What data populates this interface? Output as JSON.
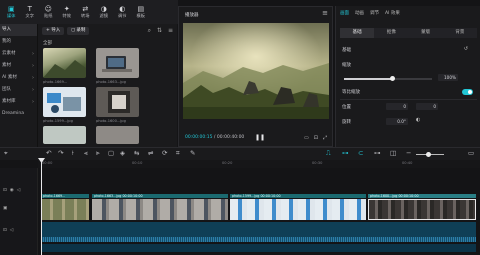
{
  "toolbar": {
    "items": [
      {
        "label": "媒体",
        "icon": "media-icon"
      },
      {
        "label": "文字",
        "icon": "text-icon"
      },
      {
        "label": "贴纸",
        "icon": "sticker-icon"
      },
      {
        "label": "特效",
        "icon": "effects-icon"
      },
      {
        "label": "转场",
        "icon": "transition-icon"
      },
      {
        "label": "滤镜",
        "icon": "filter-icon"
      },
      {
        "label": "调节",
        "icon": "adjust-icon"
      },
      {
        "label": "模板",
        "icon": "template-icon"
      }
    ]
  },
  "leftnav": {
    "items": [
      {
        "label": "导入",
        "selected": true
      },
      {
        "label": "我的",
        "selected": false
      },
      {
        "label": "云素材",
        "selected": false
      },
      {
        "label": "素材",
        "selected": false
      },
      {
        "label": "AI 素材",
        "selected": false
      },
      {
        "label": "团队",
        "selected": false
      },
      {
        "label": "素材库",
        "selected": false
      },
      {
        "label": "Dreamina",
        "selected": false
      }
    ]
  },
  "media": {
    "import_label": "导入",
    "record_label": "录制",
    "section_label": "全部",
    "thumbs": [
      {
        "name": "photo-1669..."
      },
      {
        "name": "photo-1663...jpg"
      },
      {
        "name": "photo-1599...jpg"
      },
      {
        "name": "photo-1600...jpg"
      }
    ]
  },
  "player": {
    "title": "播放器",
    "current_time": "00:00:00:15",
    "total_time": "00:00:40:00"
  },
  "props": {
    "tabs": [
      "画面",
      "动画",
      "调节",
      "AI 效果"
    ],
    "subtabs": [
      "基础",
      "抠像",
      "蒙版",
      "背景"
    ],
    "section_title": "基础",
    "scale_label": "缩放",
    "scale_value": "100%",
    "scale_level": 1.0,
    "uniform_label": "等比缩放",
    "position_label": "位置",
    "position_x": "0",
    "position_y": "0",
    "rotate_label": "旋转",
    "rotate_value": "0.0°",
    "accent": "#22c7d6"
  },
  "ruler": {
    "ticks": [
      "00:00",
      "00:10",
      "00:20",
      "00:30",
      "00:40"
    ]
  },
  "timeline": {
    "clips": [
      {
        "label": "photo-1669..."
      },
      {
        "label": "photo-1663...jpg  00:00:10:00"
      },
      {
        "label": "photo-1599...jpg  00:00:10:00"
      },
      {
        "label": "photo-1600...jpg  00:00:10:00"
      }
    ]
  }
}
